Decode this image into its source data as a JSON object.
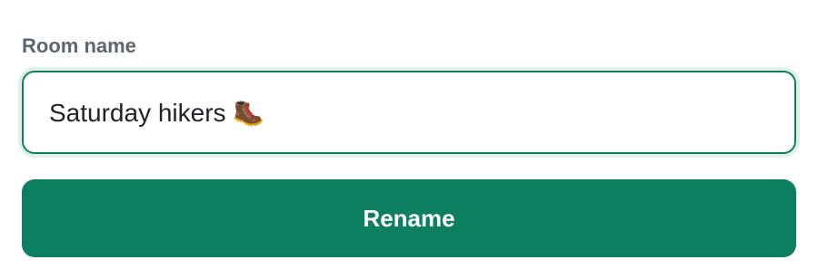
{
  "form": {
    "label": "Room name",
    "input_value": "Saturday hikers 🥾",
    "button_label": "Rename"
  },
  "colors": {
    "accent": "#0b7f5f",
    "label": "#5c6670",
    "input_focus_ring": "#e3efe9"
  }
}
